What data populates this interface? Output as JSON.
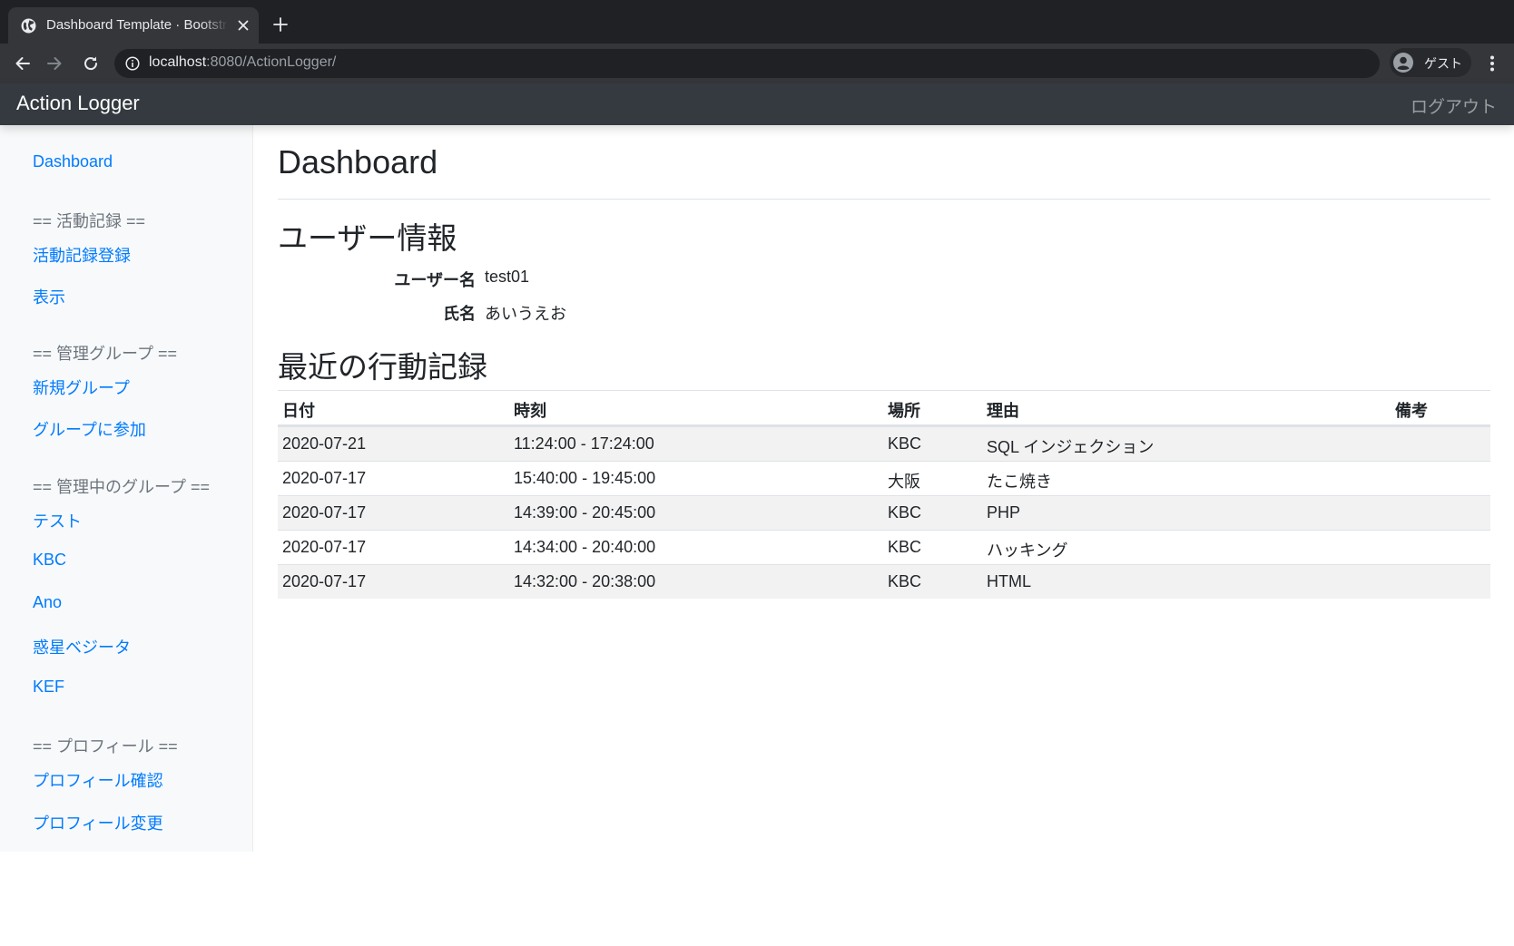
{
  "browser": {
    "tab_title": "Dashboard Template · Bootstrap",
    "url_host": "localhost",
    "url_rest": ":8080/ActionLogger/",
    "profile_label": "ゲスト"
  },
  "navbar": {
    "brand": "Action Logger",
    "logout_label": "ログアウト"
  },
  "sidebar": {
    "dashboard": "Dashboard",
    "activity_heading": "== 活動記録 ==",
    "activity_register": "活動記録登録",
    "activity_view": "表示",
    "admin_group_heading": "== 管理グループ ==",
    "new_group": "新規グループ",
    "join_group": "グループに参加",
    "managed_groups_heading": "== 管理中のグループ ==",
    "managed_groups": [
      "テスト",
      "KBC",
      "Ano",
      "惑星ベジータ",
      "KEF"
    ],
    "profile_heading": "== プロフィール ==",
    "profile_view": "プロフィール確認",
    "profile_edit": "プロフィール変更"
  },
  "main": {
    "title": "Dashboard",
    "user_info_heading": "ユーザー情報",
    "username_label": "ユーザー名",
    "username_value": "test01",
    "fullname_label": "氏名",
    "fullname_value": "あいうえお",
    "recent_heading": "最近の行動記録",
    "table": {
      "headers": [
        "日付",
        "時刻",
        "場所",
        "理由",
        "備考"
      ],
      "rows": [
        [
          "2020-07-21",
          "11:24:00 - 17:24:00",
          "KBC",
          "SQL インジェクション",
          ""
        ],
        [
          "2020-07-17",
          "15:40:00 - 19:45:00",
          "大阪",
          "たこ焼き",
          ""
        ],
        [
          "2020-07-17",
          "14:39:00 - 20:45:00",
          "KBC",
          "PHP",
          ""
        ],
        [
          "2020-07-17",
          "14:34:00 - 20:40:00",
          "KBC",
          "ハッキング",
          ""
        ],
        [
          "2020-07-17",
          "14:32:00 - 20:38:00",
          "KBC",
          "HTML",
          ""
        ]
      ]
    }
  },
  "colors": {
    "link": "#007bff",
    "navbar": "#343a40",
    "sidebar": "#f8f9fa",
    "muted": "#6c757d"
  },
  "icons": [
    "globe-icon",
    "close-icon",
    "plus-icon",
    "back-icon",
    "forward-icon",
    "reload-icon",
    "info-icon",
    "profile-icon",
    "more-vert-icon"
  ]
}
